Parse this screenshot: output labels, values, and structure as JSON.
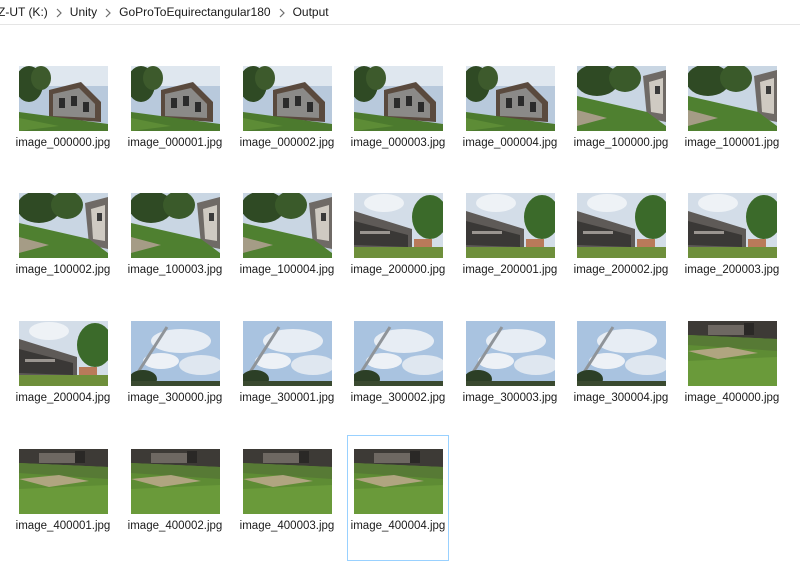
{
  "breadcrumb": [
    {
      "label": "Z-UT (K:)"
    },
    {
      "label": "Unity"
    },
    {
      "label": "GoProToEquirectangular180"
    },
    {
      "label": "Output"
    }
  ],
  "files": [
    {
      "name": "image_000000.jpg",
      "scene": "house"
    },
    {
      "name": "image_000001.jpg",
      "scene": "house"
    },
    {
      "name": "image_000002.jpg",
      "scene": "house"
    },
    {
      "name": "image_000003.jpg",
      "scene": "house"
    },
    {
      "name": "image_000004.jpg",
      "scene": "house"
    },
    {
      "name": "image_100000.jpg",
      "scene": "house-right"
    },
    {
      "name": "image_100001.jpg",
      "scene": "house-right"
    },
    {
      "name": "image_100002.jpg",
      "scene": "house-right"
    },
    {
      "name": "image_100003.jpg",
      "scene": "house-right"
    },
    {
      "name": "image_100004.jpg",
      "scene": "house-right"
    },
    {
      "name": "image_200000.jpg",
      "scene": "porch"
    },
    {
      "name": "image_200001.jpg",
      "scene": "porch"
    },
    {
      "name": "image_200002.jpg",
      "scene": "porch"
    },
    {
      "name": "image_200003.jpg",
      "scene": "porch"
    },
    {
      "name": "image_200004.jpg",
      "scene": "porch"
    },
    {
      "name": "image_300000.jpg",
      "scene": "sky"
    },
    {
      "name": "image_300001.jpg",
      "scene": "sky"
    },
    {
      "name": "image_300002.jpg",
      "scene": "sky"
    },
    {
      "name": "image_300003.jpg",
      "scene": "sky"
    },
    {
      "name": "image_300004.jpg",
      "scene": "sky"
    },
    {
      "name": "image_400000.jpg",
      "scene": "lawn"
    },
    {
      "name": "image_400001.jpg",
      "scene": "lawn"
    },
    {
      "name": "image_400002.jpg",
      "scene": "lawn"
    },
    {
      "name": "image_400003.jpg",
      "scene": "lawn"
    },
    {
      "name": "image_400004.jpg",
      "scene": "lawn",
      "selected": true
    }
  ],
  "colors": {
    "selection_border": "#99d1ff",
    "text": "#1a1a1a"
  }
}
